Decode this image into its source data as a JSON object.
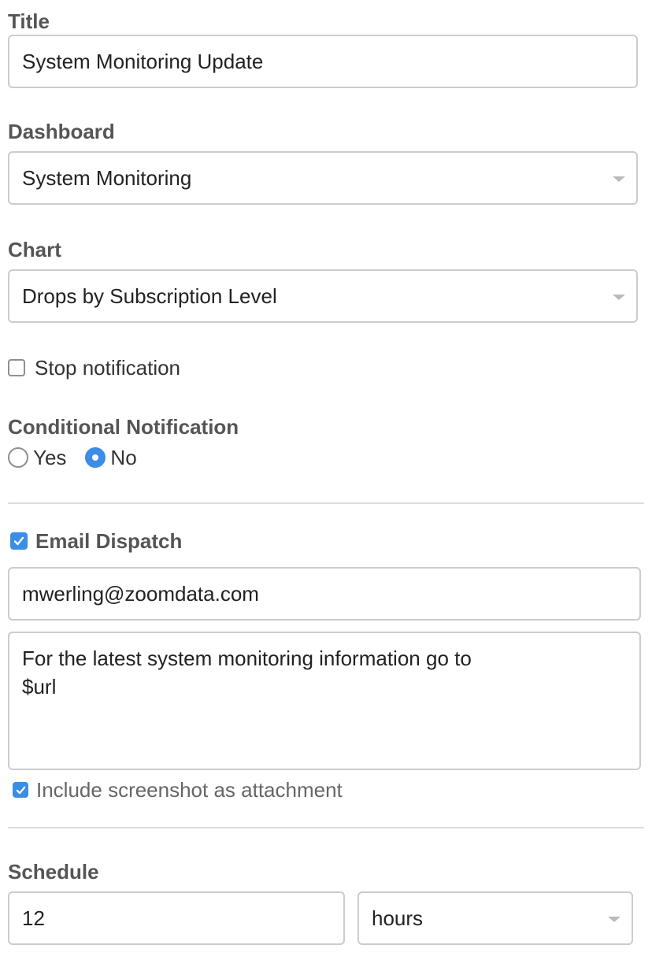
{
  "title": {
    "label": "Title",
    "value": "System Monitoring Update"
  },
  "dashboard": {
    "label": "Dashboard",
    "value": "System Monitoring"
  },
  "chart": {
    "label": "Chart",
    "value": "Drops by Subscription Level"
  },
  "stop_notification": {
    "label": "Stop notification",
    "checked": false
  },
  "conditional_notification": {
    "label": "Conditional Notification",
    "options": [
      {
        "label": "Yes",
        "selected": false
      },
      {
        "label": "No",
        "selected": true
      }
    ]
  },
  "email_dispatch": {
    "label": "Email Dispatch",
    "checked": true,
    "email": "mwerling@zoomdata.com",
    "message": "For the latest system monitoring information go to\n$url",
    "include_screenshot": {
      "label": "Include screenshot as attachment",
      "checked": true
    }
  },
  "schedule": {
    "label": "Schedule",
    "interval": "12",
    "unit": "hours"
  },
  "colors": {
    "accent": "#3b8de6",
    "label": "#555555",
    "border": "#cccccc",
    "divider": "#dddddd"
  },
  "icons": {
    "select_caret": "chevron-down-icon",
    "check": "check-icon",
    "radio_dot": "radio-dot-icon"
  }
}
